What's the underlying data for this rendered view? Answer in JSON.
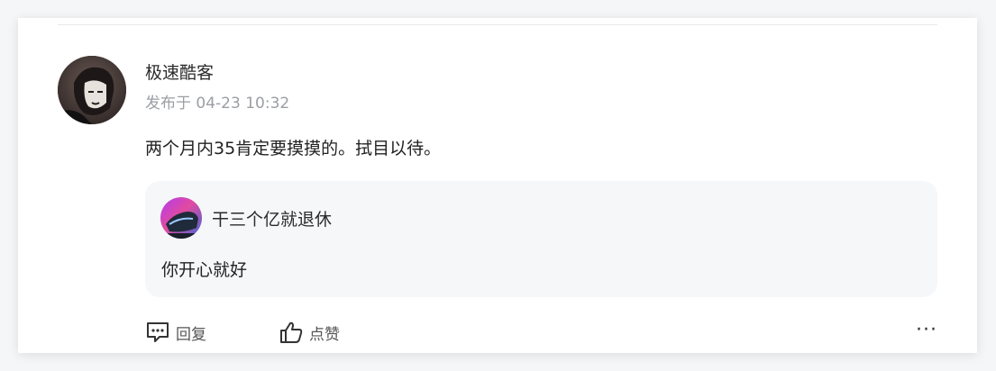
{
  "comment": {
    "author": "极速酷客",
    "posted_at": "发布于 04-23 10:32",
    "text": "两个月内35肯定要摸摸的。拭目以待。"
  },
  "reply": {
    "author": "干三个亿就退休",
    "text": "你开心就好"
  },
  "actions": {
    "reply_label": "回复",
    "like_label": "点赞",
    "more_label": "···"
  },
  "icons": {
    "reply": "comment-bubble-icon",
    "like": "thumbs-up-icon",
    "more": "ellipsis-icon"
  }
}
